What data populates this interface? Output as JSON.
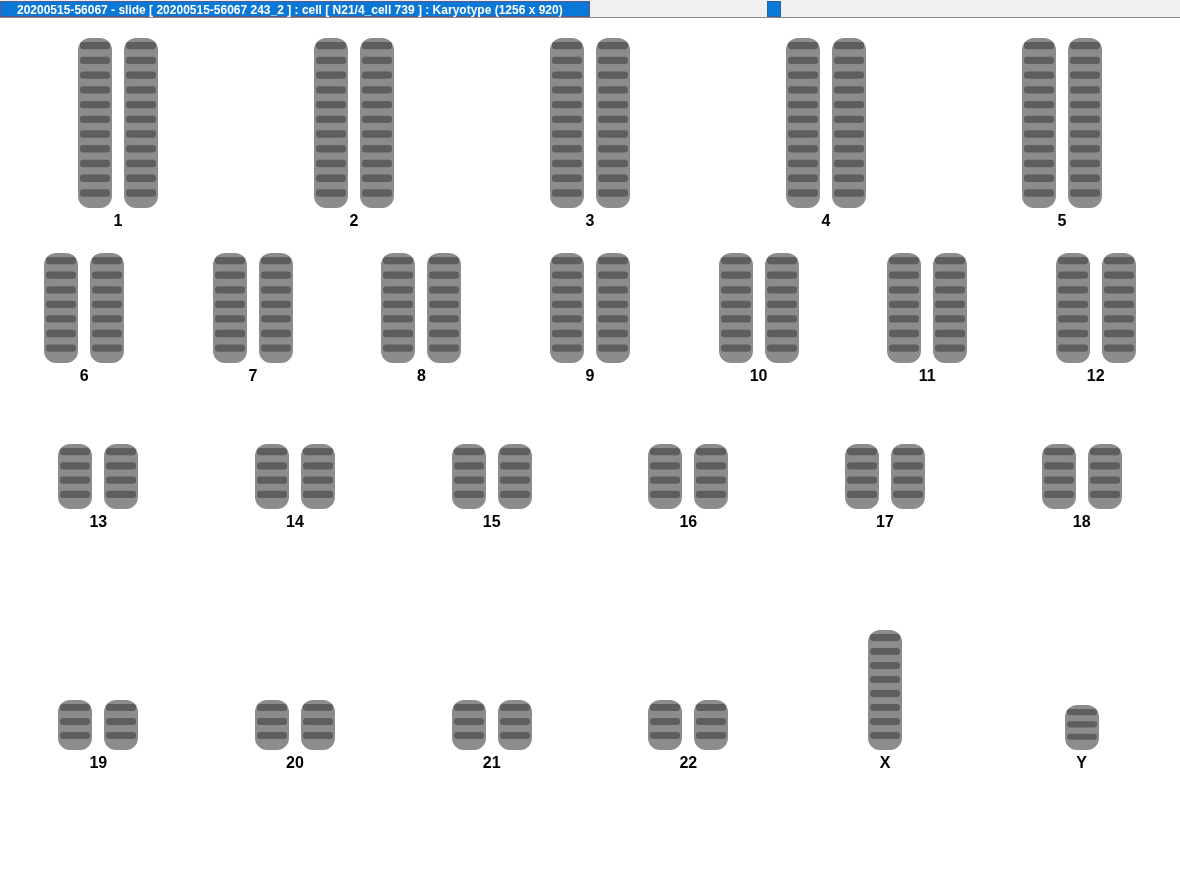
{
  "window": {
    "title": "20200515-56067 - slide [ 20200515-56067 243_2 ] : cell [ N21/4_cell 739 ] : Karyotype  (1256 x 920)"
  },
  "rows": [
    {
      "items": [
        {
          "label": "1",
          "kind": "pair"
        },
        {
          "label": "2",
          "kind": "pair"
        },
        {
          "label": "3",
          "kind": "pair"
        },
        {
          "label": "4",
          "kind": "pair"
        },
        {
          "label": "5",
          "kind": "pair"
        }
      ]
    },
    {
      "items": [
        {
          "label": "6",
          "kind": "pair"
        },
        {
          "label": "7",
          "kind": "pair"
        },
        {
          "label": "8",
          "kind": "pair"
        },
        {
          "label": "9",
          "kind": "pair"
        },
        {
          "label": "10",
          "kind": "pair"
        },
        {
          "label": "11",
          "kind": "pair"
        },
        {
          "label": "12",
          "kind": "pair"
        }
      ]
    },
    {
      "items": [
        {
          "label": "13",
          "kind": "pair"
        },
        {
          "label": "14",
          "kind": "pair"
        },
        {
          "label": "15",
          "kind": "pair"
        },
        {
          "label": "16",
          "kind": "pair"
        },
        {
          "label": "17",
          "kind": "pair"
        },
        {
          "label": "18",
          "kind": "pair"
        }
      ]
    },
    {
      "items": [
        {
          "label": "19",
          "kind": "pair"
        },
        {
          "label": "20",
          "kind": "pair"
        },
        {
          "label": "21",
          "kind": "pair"
        },
        {
          "label": "22",
          "kind": "pair"
        },
        {
          "label": "X",
          "kind": "single"
        },
        {
          "label": "Y",
          "kind": "single"
        }
      ]
    }
  ]
}
